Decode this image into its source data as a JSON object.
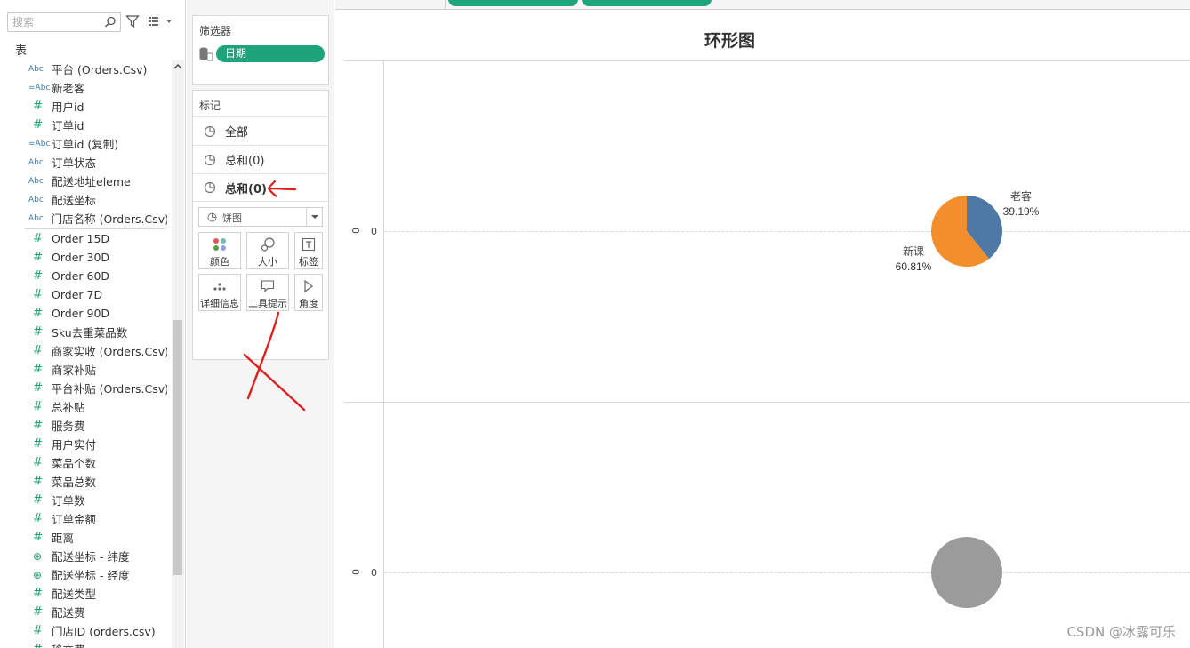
{
  "data_pane": {
    "search_placeholder": "搜索",
    "tables_title": "表",
    "fields": [
      {
        "type": "Abc",
        "kind": "dim",
        "name": "平台 (Orders.Csv)"
      },
      {
        "type": "=Abc",
        "kind": "dim",
        "name": "新老客"
      },
      {
        "type": "#",
        "kind": "measure",
        "name": "用户id"
      },
      {
        "type": "#",
        "kind": "measure",
        "name": "订单id"
      },
      {
        "type": "=Abc",
        "kind": "dim",
        "name": "订单id (复制)"
      },
      {
        "type": "Abc",
        "kind": "dim",
        "name": "订单状态"
      },
      {
        "type": "Abc",
        "kind": "dim",
        "name": "配送地址eleme"
      },
      {
        "type": "Abc",
        "kind": "dim",
        "name": "配送坐标"
      },
      {
        "type": "Abc",
        "kind": "dim",
        "name": "门店名称 (Orders.Csv)"
      },
      {
        "type": "#",
        "kind": "measure",
        "name": "Order 15D"
      },
      {
        "type": "#",
        "kind": "measure",
        "name": "Order 30D"
      },
      {
        "type": "#",
        "kind": "measure",
        "name": "Order 60D"
      },
      {
        "type": "#",
        "kind": "measure",
        "name": "Order 7D"
      },
      {
        "type": "#",
        "kind": "measure",
        "name": "Order 90D"
      },
      {
        "type": "#",
        "kind": "measure",
        "name": "Sku去重菜品数"
      },
      {
        "type": "#",
        "kind": "measure",
        "name": "商家实收 (Orders.Csv)"
      },
      {
        "type": "#",
        "kind": "measure",
        "name": "商家补贴"
      },
      {
        "type": "#",
        "kind": "measure",
        "name": "平台补贴 (Orders.Csv)"
      },
      {
        "type": "#",
        "kind": "measure",
        "name": "总补贴"
      },
      {
        "type": "#",
        "kind": "measure",
        "name": "服务费"
      },
      {
        "type": "#",
        "kind": "measure",
        "name": "用户实付"
      },
      {
        "type": "#",
        "kind": "measure",
        "name": "菜品个数"
      },
      {
        "type": "#",
        "kind": "measure",
        "name": "菜品总数"
      },
      {
        "type": "#",
        "kind": "measure",
        "name": "订单数"
      },
      {
        "type": "#",
        "kind": "measure",
        "name": "订单金额"
      },
      {
        "type": "#",
        "kind": "measure",
        "name": "距离"
      },
      {
        "type": "globe",
        "kind": "geo",
        "name": "配送坐标 - 纬度"
      },
      {
        "type": "globe",
        "kind": "geo",
        "name": "配送坐标 - 经度"
      },
      {
        "type": "#",
        "kind": "measure",
        "name": "配送类型"
      },
      {
        "type": "#",
        "kind": "measure",
        "name": "配送费"
      },
      {
        "type": "#",
        "kind": "measure",
        "name": "门店ID (orders.csv)"
      },
      {
        "type": "#",
        "kind": "measure",
        "name": "移交费"
      }
    ]
  },
  "filters": {
    "title": "筛选器",
    "pill": "日期"
  },
  "marks": {
    "title": "标记",
    "rows": [
      "全部",
      "总和(0)",
      "总和(0)"
    ],
    "mark_type": "饼图",
    "buttons": {
      "color": "颜色",
      "size": "大小",
      "label": "标签",
      "detail": "详细信息",
      "tooltip": "工具提示",
      "angle": "角度"
    }
  },
  "view": {
    "title": "环形图",
    "axis_tick_top": "0",
    "axis_tick_bottom": "0"
  },
  "colors": {
    "pill_green": "#1fa37a",
    "laoke": "#4e79a7",
    "xinke": "#f28e2b",
    "hole": "#9b9b9b",
    "annotation_red": "#e02020"
  },
  "chart_data": [
    {
      "type": "pie",
      "title": "环形图",
      "slices": [
        {
          "label": "老客",
          "value": 39.19,
          "value_label": "39.19%",
          "color": "#4e79a7"
        },
        {
          "label": "新课",
          "value": 60.81,
          "value_label": "60.81%",
          "color": "#f28e2b"
        }
      ]
    },
    {
      "type": "pie",
      "slices": [
        {
          "label": "",
          "value": 100,
          "color": "#9b9b9b"
        }
      ]
    }
  ],
  "watermark": "CSDN @冰露可乐"
}
